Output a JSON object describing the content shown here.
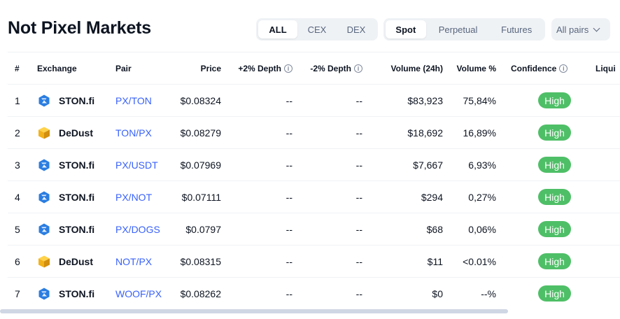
{
  "page": {
    "title": "Not Pixel Markets"
  },
  "filters": {
    "type_tabs": [
      "ALL",
      "CEX",
      "DEX"
    ],
    "type_active": "ALL",
    "market_tabs": [
      "Spot",
      "Perpetual",
      "Futures"
    ],
    "market_active": "Spot",
    "pairs_dropdown": "All pairs"
  },
  "table": {
    "headers": {
      "index": "#",
      "exchange": "Exchange",
      "pair": "Pair",
      "price": "Price",
      "plus_depth": "+2% Depth",
      "minus_depth": "-2% Depth",
      "volume": "Volume (24h)",
      "volume_pct": "Volume %",
      "confidence": "Confidence",
      "liquidity": "Liqui"
    },
    "rows": [
      {
        "index": "1",
        "exchange": "STON.fi",
        "icon": "ston-fi-icon",
        "pair": "PX/TON",
        "price": "$0.08324",
        "plus_depth": "--",
        "minus_depth": "--",
        "volume": "$83,923",
        "volume_pct": "75,84%",
        "confidence": "High"
      },
      {
        "index": "2",
        "exchange": "DeDust",
        "icon": "dedust-icon",
        "pair": "TON/PX",
        "price": "$0.08279",
        "plus_depth": "--",
        "minus_depth": "--",
        "volume": "$18,692",
        "volume_pct": "16,89%",
        "confidence": "High"
      },
      {
        "index": "3",
        "exchange": "STON.fi",
        "icon": "ston-fi-icon",
        "pair": "PX/USDT",
        "price": "$0.07969",
        "plus_depth": "--",
        "minus_depth": "--",
        "volume": "$7,667",
        "volume_pct": "6,93%",
        "confidence": "High"
      },
      {
        "index": "4",
        "exchange": "STON.fi",
        "icon": "ston-fi-icon",
        "pair": "PX/NOT",
        "price": "$0.07111",
        "plus_depth": "--",
        "minus_depth": "--",
        "volume": "$294",
        "volume_pct": "0,27%",
        "confidence": "High"
      },
      {
        "index": "5",
        "exchange": "STON.fi",
        "icon": "ston-fi-icon",
        "pair": "PX/DOGS",
        "price": "$0.0797",
        "plus_depth": "--",
        "minus_depth": "--",
        "volume": "$68",
        "volume_pct": "0,06%",
        "confidence": "High"
      },
      {
        "index": "6",
        "exchange": "DeDust",
        "icon": "dedust-icon",
        "pair": "NOT/PX",
        "price": "$0.08315",
        "plus_depth": "--",
        "minus_depth": "--",
        "volume": "$11",
        "volume_pct": "<0.01%",
        "confidence": "High"
      },
      {
        "index": "7",
        "exchange": "STON.fi",
        "icon": "ston-fi-icon",
        "pair": "WOOF/PX",
        "price": "$0.08262",
        "plus_depth": "--",
        "minus_depth": "--",
        "volume": "$0",
        "volume_pct": "--%",
        "confidence": "High"
      }
    ]
  },
  "colors": {
    "link": "#3861fb",
    "badge_high": "#4fbf67",
    "ston_blue": "#2a7de1",
    "dedust_gold": "#f2b21b"
  }
}
